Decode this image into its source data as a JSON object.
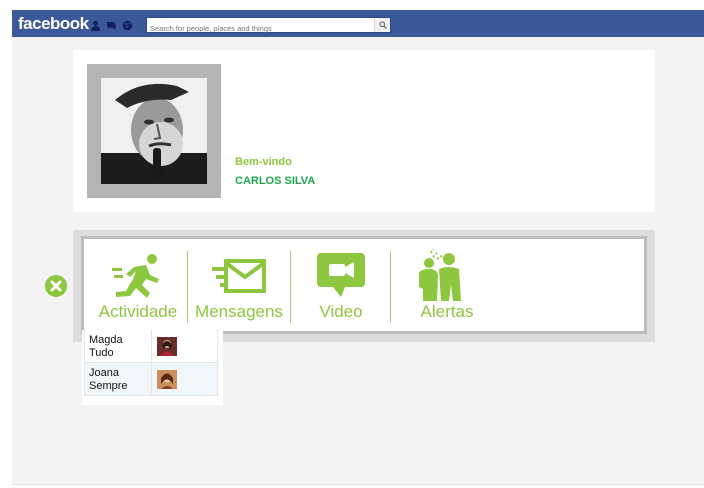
{
  "header": {
    "logo_text": "facebook",
    "icons": [
      "friend-requests-icon",
      "messages-icon",
      "notifications-globe-icon"
    ],
    "search_placeholder": "Search for people, places and things",
    "search_button_icon": "magnifier-icon"
  },
  "profile": {
    "welcome": "Bem-vindo",
    "name": "CARLOS SILVA",
    "photo_icon": "profile-photo"
  },
  "menu": {
    "items": [
      {
        "label": "Actividade",
        "icon": "running-man-icon"
      },
      {
        "label": "Mensagens",
        "icon": "envelope-icon"
      },
      {
        "label": "Video",
        "icon": "video-camera-icon"
      },
      {
        "label": "Alertas",
        "icon": "people-alert-icon"
      }
    ],
    "close_icon": "close-circle-icon"
  },
  "contacts": [
    {
      "name_line1": "Magda",
      "name_line2": "Tudo"
    },
    {
      "name_line1": "Joana",
      "name_line2": "Sempre"
    }
  ],
  "colors": {
    "facebook_blue": "#3b5998",
    "accent_green": "#8dc63f",
    "name_green": "#1aa84b"
  }
}
